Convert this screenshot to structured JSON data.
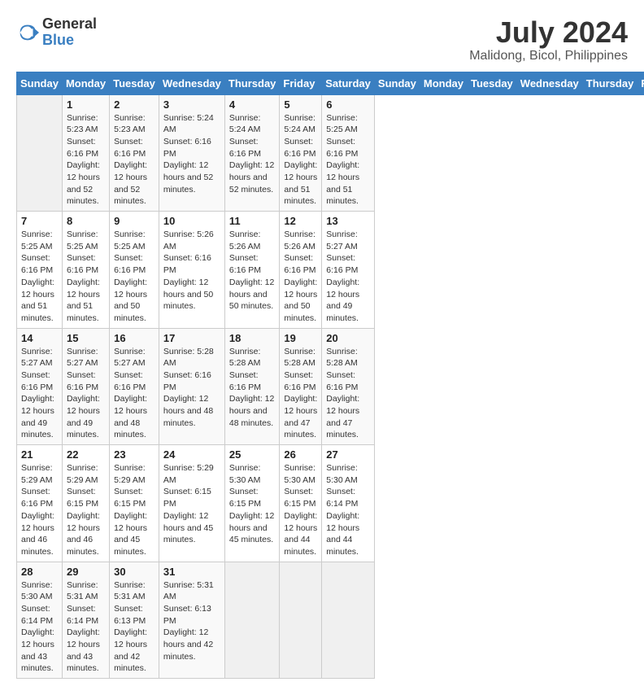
{
  "header": {
    "logo_line1": "General",
    "logo_line2": "Blue",
    "month_year": "July 2024",
    "location": "Malidong, Bicol, Philippines"
  },
  "days_of_week": [
    "Sunday",
    "Monday",
    "Tuesday",
    "Wednesday",
    "Thursday",
    "Friday",
    "Saturday"
  ],
  "weeks": [
    [
      {
        "day": "",
        "empty": true
      },
      {
        "day": "1",
        "sunrise": "5:23 AM",
        "sunset": "6:16 PM",
        "daylight": "12 hours and 52 minutes."
      },
      {
        "day": "2",
        "sunrise": "5:23 AM",
        "sunset": "6:16 PM",
        "daylight": "12 hours and 52 minutes."
      },
      {
        "day": "3",
        "sunrise": "5:24 AM",
        "sunset": "6:16 PM",
        "daylight": "12 hours and 52 minutes."
      },
      {
        "day": "4",
        "sunrise": "5:24 AM",
        "sunset": "6:16 PM",
        "daylight": "12 hours and 52 minutes."
      },
      {
        "day": "5",
        "sunrise": "5:24 AM",
        "sunset": "6:16 PM",
        "daylight": "12 hours and 51 minutes."
      },
      {
        "day": "6",
        "sunrise": "5:25 AM",
        "sunset": "6:16 PM",
        "daylight": "12 hours and 51 minutes."
      }
    ],
    [
      {
        "day": "7",
        "sunrise": "5:25 AM",
        "sunset": "6:16 PM",
        "daylight": "12 hours and 51 minutes."
      },
      {
        "day": "8",
        "sunrise": "5:25 AM",
        "sunset": "6:16 PM",
        "daylight": "12 hours and 51 minutes."
      },
      {
        "day": "9",
        "sunrise": "5:25 AM",
        "sunset": "6:16 PM",
        "daylight": "12 hours and 50 minutes."
      },
      {
        "day": "10",
        "sunrise": "5:26 AM",
        "sunset": "6:16 PM",
        "daylight": "12 hours and 50 minutes."
      },
      {
        "day": "11",
        "sunrise": "5:26 AM",
        "sunset": "6:16 PM",
        "daylight": "12 hours and 50 minutes."
      },
      {
        "day": "12",
        "sunrise": "5:26 AM",
        "sunset": "6:16 PM",
        "daylight": "12 hours and 50 minutes."
      },
      {
        "day": "13",
        "sunrise": "5:27 AM",
        "sunset": "6:16 PM",
        "daylight": "12 hours and 49 minutes."
      }
    ],
    [
      {
        "day": "14",
        "sunrise": "5:27 AM",
        "sunset": "6:16 PM",
        "daylight": "12 hours and 49 minutes."
      },
      {
        "day": "15",
        "sunrise": "5:27 AM",
        "sunset": "6:16 PM",
        "daylight": "12 hours and 49 minutes."
      },
      {
        "day": "16",
        "sunrise": "5:27 AM",
        "sunset": "6:16 PM",
        "daylight": "12 hours and 48 minutes."
      },
      {
        "day": "17",
        "sunrise": "5:28 AM",
        "sunset": "6:16 PM",
        "daylight": "12 hours and 48 minutes."
      },
      {
        "day": "18",
        "sunrise": "5:28 AM",
        "sunset": "6:16 PM",
        "daylight": "12 hours and 48 minutes."
      },
      {
        "day": "19",
        "sunrise": "5:28 AM",
        "sunset": "6:16 PM",
        "daylight": "12 hours and 47 minutes."
      },
      {
        "day": "20",
        "sunrise": "5:28 AM",
        "sunset": "6:16 PM",
        "daylight": "12 hours and 47 minutes."
      }
    ],
    [
      {
        "day": "21",
        "sunrise": "5:29 AM",
        "sunset": "6:16 PM",
        "daylight": "12 hours and 46 minutes."
      },
      {
        "day": "22",
        "sunrise": "5:29 AM",
        "sunset": "6:15 PM",
        "daylight": "12 hours and 46 minutes."
      },
      {
        "day": "23",
        "sunrise": "5:29 AM",
        "sunset": "6:15 PM",
        "daylight": "12 hours and 45 minutes."
      },
      {
        "day": "24",
        "sunrise": "5:29 AM",
        "sunset": "6:15 PM",
        "daylight": "12 hours and 45 minutes."
      },
      {
        "day": "25",
        "sunrise": "5:30 AM",
        "sunset": "6:15 PM",
        "daylight": "12 hours and 45 minutes."
      },
      {
        "day": "26",
        "sunrise": "5:30 AM",
        "sunset": "6:15 PM",
        "daylight": "12 hours and 44 minutes."
      },
      {
        "day": "27",
        "sunrise": "5:30 AM",
        "sunset": "6:14 PM",
        "daylight": "12 hours and 44 minutes."
      }
    ],
    [
      {
        "day": "28",
        "sunrise": "5:30 AM",
        "sunset": "6:14 PM",
        "daylight": "12 hours and 43 minutes."
      },
      {
        "day": "29",
        "sunrise": "5:31 AM",
        "sunset": "6:14 PM",
        "daylight": "12 hours and 43 minutes."
      },
      {
        "day": "30",
        "sunrise": "5:31 AM",
        "sunset": "6:13 PM",
        "daylight": "12 hours and 42 minutes."
      },
      {
        "day": "31",
        "sunrise": "5:31 AM",
        "sunset": "6:13 PM",
        "daylight": "12 hours and 42 minutes."
      },
      {
        "day": "",
        "empty": true
      },
      {
        "day": "",
        "empty": true
      },
      {
        "day": "",
        "empty": true
      }
    ]
  ],
  "labels": {
    "sunrise_prefix": "Sunrise: ",
    "sunset_prefix": "Sunset: ",
    "daylight_prefix": "Daylight: "
  }
}
